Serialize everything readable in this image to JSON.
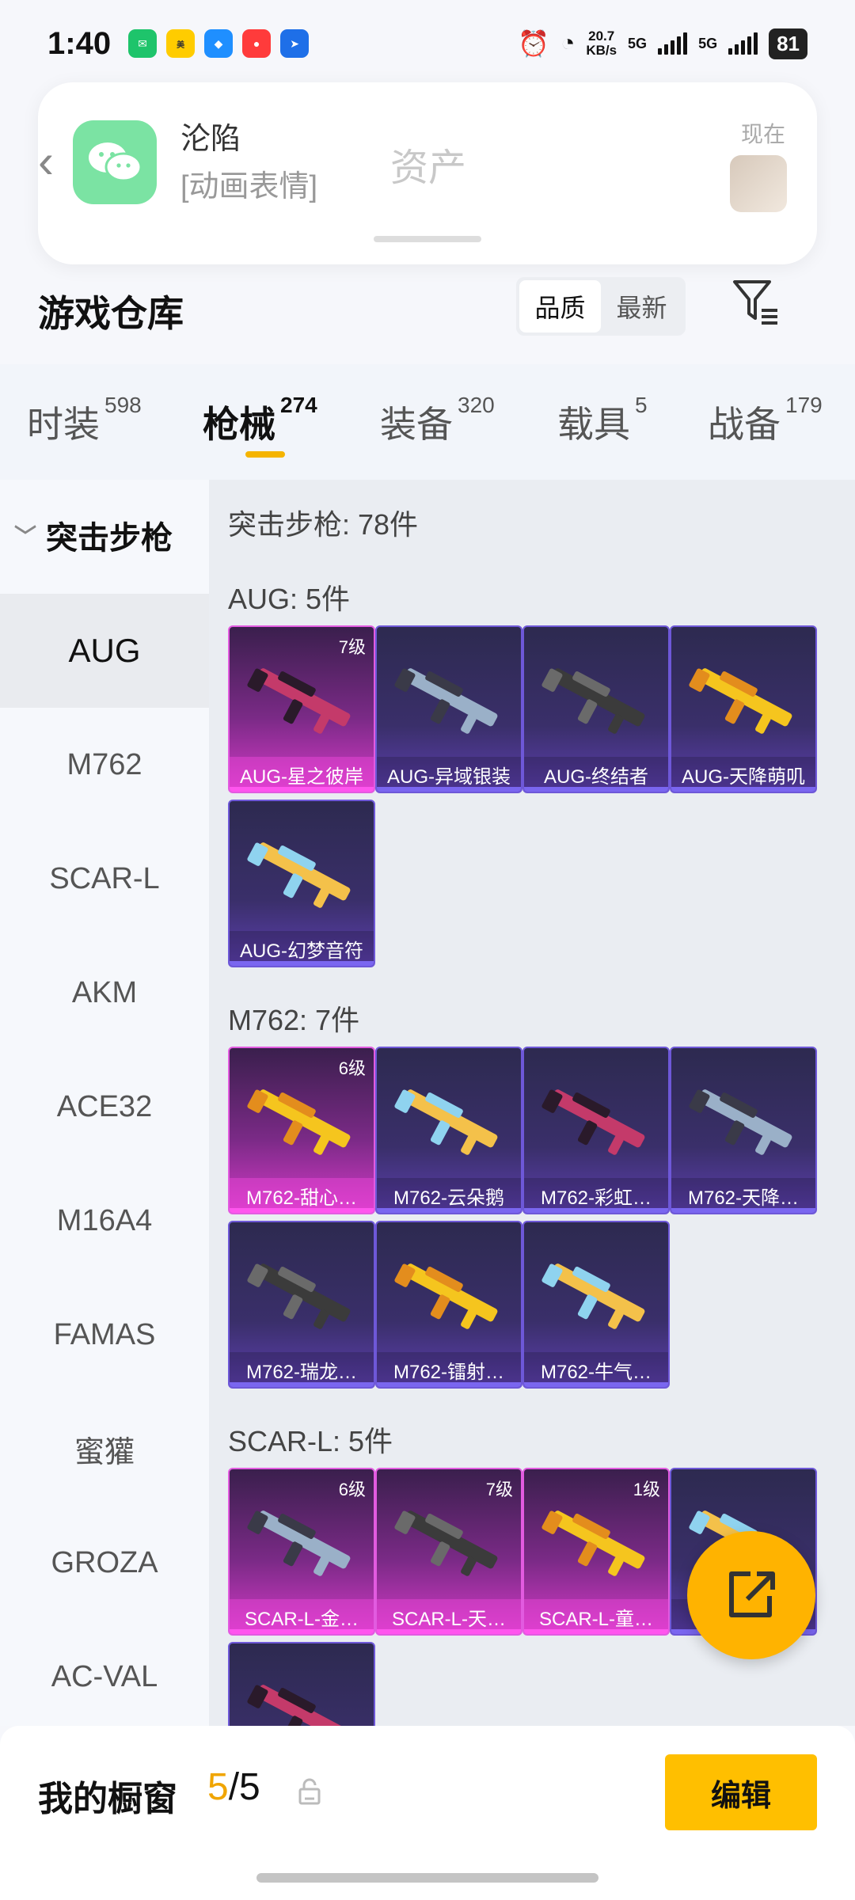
{
  "status_bar": {
    "time": "1:40",
    "speed_value": "20.7",
    "speed_unit": "KB/s",
    "network_1": "5G",
    "network_2": "5G",
    "battery": "81",
    "app_icons": [
      "wechat-icon",
      "meituan-icon",
      "browser-icon",
      "app-icon",
      "messenger-icon"
    ]
  },
  "notification": {
    "title": "沦陷",
    "subtitle": "[动画表情]",
    "center_text": "资产",
    "time": "现在"
  },
  "header": {
    "title": "游戏仓库",
    "sort_options": [
      "品质",
      "最新"
    ],
    "sort_selected": "品质"
  },
  "categories": [
    {
      "label": "时装",
      "count": "598"
    },
    {
      "label": "枪械",
      "count": "274",
      "active": true
    },
    {
      "label": "装备",
      "count": "320"
    },
    {
      "label": "载具",
      "count": "5"
    },
    {
      "label": "战备",
      "count": "179"
    }
  ],
  "sidebar": {
    "group": "突击步枪",
    "items": [
      "AUG",
      "M762",
      "SCAR-L",
      "AKM",
      "ACE32",
      "M16A4",
      "FAMAS",
      "蜜獾",
      "GROZA",
      "AC-VAL"
    ],
    "selected": "AUG"
  },
  "main": {
    "summary": "突击步枪: 78件",
    "sections": [
      {
        "title": "AUG: 5件",
        "items": [
          {
            "name": "AUG-星之彼岸",
            "level": "7级",
            "epic": true
          },
          {
            "name": "AUG-异域银装",
            "level": "",
            "epic": false
          },
          {
            "name": "AUG-终结者",
            "level": "",
            "epic": false
          },
          {
            "name": "AUG-天降萌叽",
            "level": "",
            "epic": false
          },
          {
            "name": "AUG-幻梦音符",
            "level": "",
            "epic": false
          }
        ]
      },
      {
        "title": "M762: 7件",
        "items": [
          {
            "name": "M762-甜心…",
            "level": "6级",
            "epic": true
          },
          {
            "name": "M762-云朵鹅",
            "level": "",
            "epic": false
          },
          {
            "name": "M762-彩虹…",
            "level": "",
            "epic": false
          },
          {
            "name": "M762-天降…",
            "level": "",
            "epic": false
          },
          {
            "name": "M762-瑞龙…",
            "level": "",
            "epic": false
          },
          {
            "name": "M762-镭射…",
            "level": "",
            "epic": false
          },
          {
            "name": "M762-牛气…",
            "level": "",
            "epic": false
          }
        ]
      },
      {
        "title": "SCAR-L: 5件",
        "items": [
          {
            "name": "SCAR-L-金…",
            "level": "6级",
            "epic": true
          },
          {
            "name": "SCAR-L-天…",
            "level": "7级",
            "epic": true
          },
          {
            "name": "SCAR-L-童…",
            "level": "1级",
            "epic": true
          },
          {
            "name": "…",
            "level": "",
            "epic": false
          },
          {
            "name": "",
            "level": "",
            "epic": false
          }
        ]
      }
    ]
  },
  "bottom": {
    "showcase_label": "我的橱窗",
    "showcase_current": "5",
    "showcase_total": "/5",
    "edit_label": "编辑"
  },
  "colors": {
    "accent": "#ffbf00",
    "tab_underline": "#f5b400",
    "epic": "#d43ac7",
    "rare": "#5d3fb0"
  }
}
